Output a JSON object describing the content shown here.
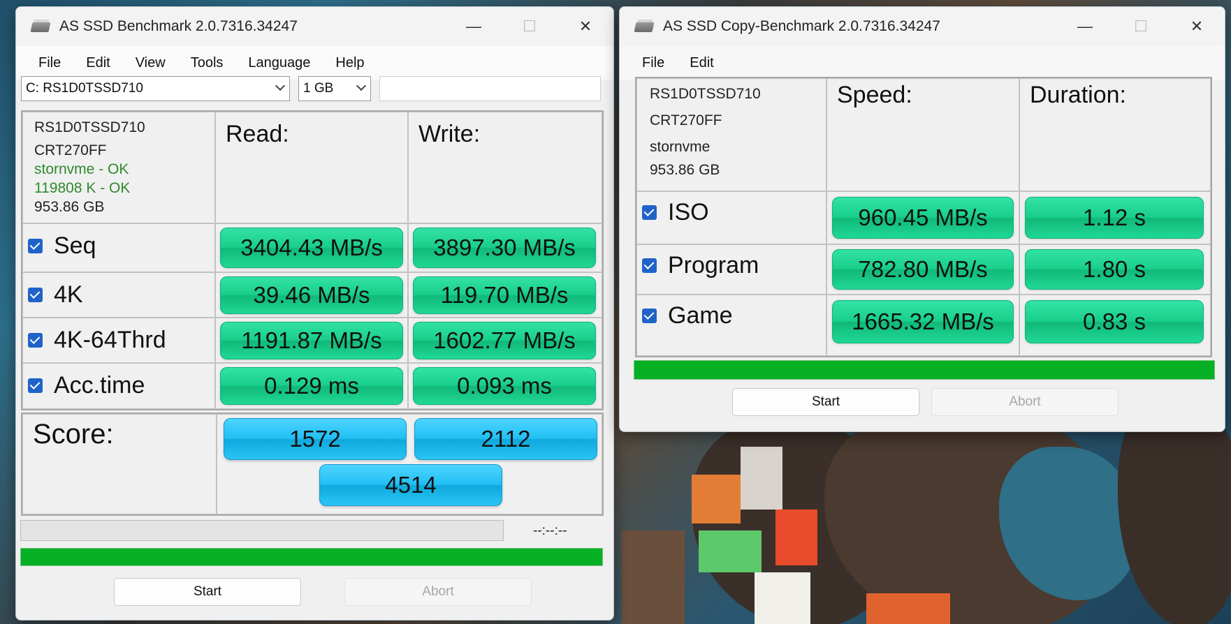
{
  "main_window": {
    "title": "AS SSD Benchmark 2.0.7316.34247",
    "menu": [
      "File",
      "Edit",
      "View",
      "Tools",
      "Language",
      "Help"
    ],
    "drive_select": "C: RS1D0TSSD710",
    "size_select": "1 GB",
    "info": {
      "model": "RS1D0TSSD710",
      "firmware": "CRT270FF",
      "driver": "stornvme - OK",
      "alignment": "119808 K - OK",
      "capacity": "953.86 GB"
    },
    "read_header": "Read:",
    "write_header": "Write:",
    "rows": [
      {
        "label": "Seq",
        "read": "3404.43 MB/s",
        "write": "3897.30 MB/s"
      },
      {
        "label": "4K",
        "read": "39.46 MB/s",
        "write": "119.70 MB/s"
      },
      {
        "label": "4K-64Thrd",
        "read": "1191.87 MB/s",
        "write": "1602.77 MB/s"
      },
      {
        "label": "Acc.time",
        "read": "0.129 ms",
        "write": "0.093 ms"
      }
    ],
    "score_label": "Score:",
    "score_read": "1572",
    "score_write": "2112",
    "score_total": "4514",
    "time_display": "--:--:--",
    "progress_fraction": 1.0,
    "start_label": "Start",
    "abort_label": "Abort"
  },
  "copy_window": {
    "title": "AS SSD Copy-Benchmark 2.0.7316.34247",
    "menu": [
      "File",
      "Edit"
    ],
    "info": {
      "model": "RS1D0TSSD710",
      "firmware": "CRT270FF",
      "driver": "stornvme",
      "capacity": "953.86 GB"
    },
    "speed_header": "Speed:",
    "duration_header": "Duration:",
    "rows": [
      {
        "label": "ISO",
        "speed": "960.45 MB/s",
        "duration": "1.12 s"
      },
      {
        "label": "Program",
        "speed": "782.80 MB/s",
        "duration": "1.80 s"
      },
      {
        "label": "Game",
        "speed": "1665.32 MB/s",
        "duration": "0.83 s"
      }
    ],
    "progress_fraction": 1.0,
    "start_label": "Start",
    "abort_label": "Abort"
  },
  "colors": {
    "result_green": "#1fd190",
    "score_blue": "#22bff3",
    "progress_green": "#06b025",
    "checkbox_blue": "#1f63c8"
  }
}
